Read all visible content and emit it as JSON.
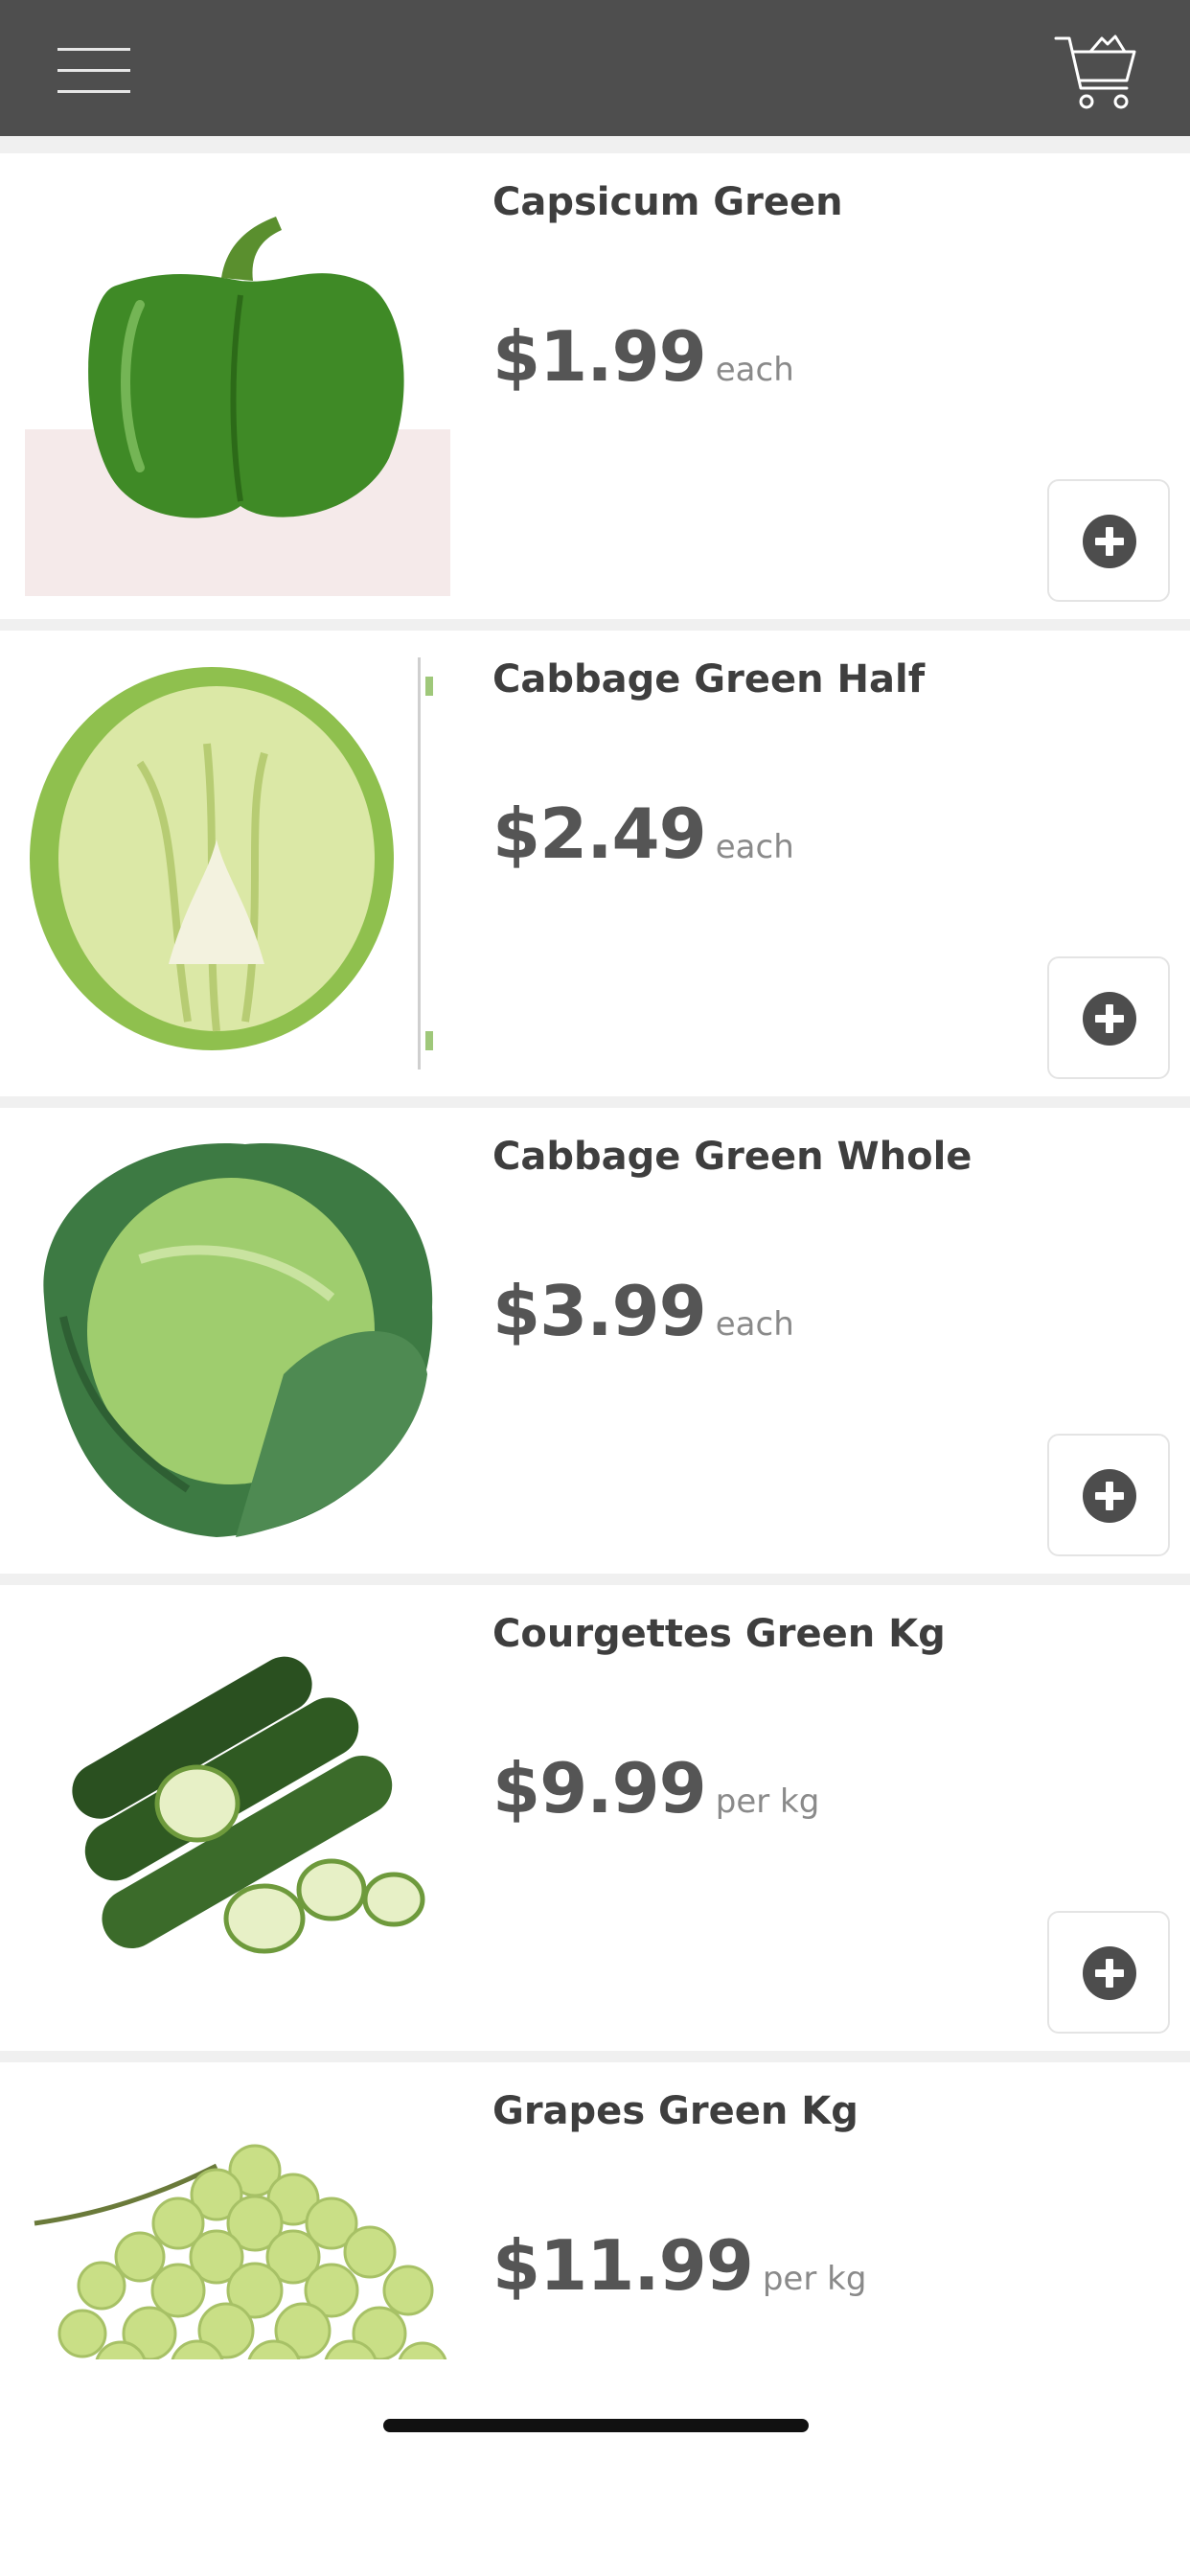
{
  "header": {
    "menu_icon": "hamburger-menu-icon",
    "cart_icon": "shopping-cart-icon",
    "background": "#4e4e4e"
  },
  "products": [
    {
      "name": "Capsicum Green",
      "price": "$1.99",
      "unit": "each",
      "image": "green-capsicum-image"
    },
    {
      "name": "Cabbage Green Half",
      "price": "$2.49",
      "unit": "each",
      "image": "cabbage-half-image"
    },
    {
      "name": "Cabbage Green Whole",
      "price": "$3.99",
      "unit": "each",
      "image": "cabbage-whole-image"
    },
    {
      "name": "Courgettes Green Kg",
      "price": "$9.99",
      "unit": "per kg",
      "image": "courgettes-image"
    },
    {
      "name": "Grapes Green Kg",
      "price": "$11.99",
      "unit": "per kg",
      "image": "green-grapes-image"
    }
  ],
  "add_icon": "plus-circle-icon",
  "colors": {
    "text_dark": "#3e3e3e",
    "price": "#555555",
    "unit": "#8a8a8a"
  }
}
